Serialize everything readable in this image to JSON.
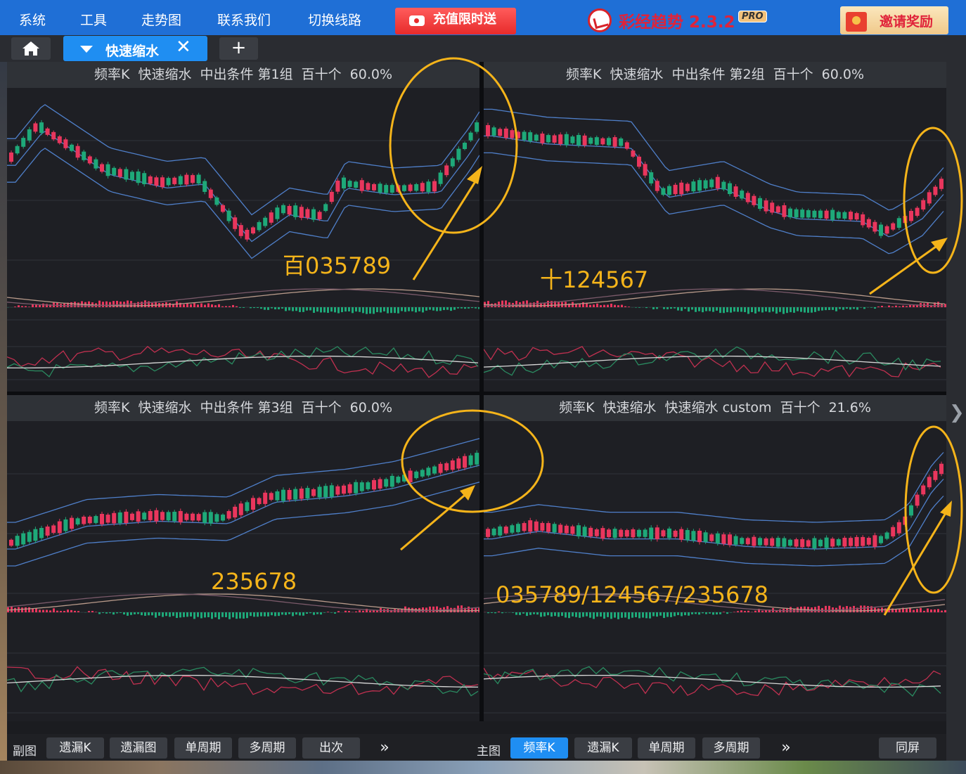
{
  "menu": {
    "items": [
      "系统",
      "工具",
      "走势图",
      "联系我们",
      "切换线路"
    ],
    "promo_label": "充值限时送",
    "app_title": "彩经趋势 2.3.2",
    "pro_badge": "PRO",
    "invite_label": "邀请奖励"
  },
  "tabs": {
    "active_label": "快速缩水",
    "close_glyph": "✕",
    "add_glyph": "+"
  },
  "panels": [
    {
      "title": [
        "频率K",
        "快速缩水",
        "中出条件 第1组",
        "百十个",
        "60.0%"
      ],
      "annotation": "百035789"
    },
    {
      "title": [
        "频率K",
        "快速缩水",
        "中出条件 第2组",
        "百十个",
        "60.0%"
      ],
      "annotation": "十124567"
    },
    {
      "title": [
        "频率K",
        "快速缩水",
        "中出条件 第3组",
        "百十个",
        "60.0%"
      ],
      "annotation": "235678"
    },
    {
      "title": [
        "频率K",
        "快速缩水",
        "快速缩水 custom",
        "百十个",
        "21.6%"
      ],
      "annotation": "035789/124567/235678"
    }
  ],
  "bottom": {
    "left_label": "副图",
    "left_buttons": [
      "遗漏K",
      "遗漏图",
      "单周期",
      "多周期",
      "出次"
    ],
    "right_label": "主图",
    "right_buttons": [
      "频率K",
      "遗漏K",
      "单周期",
      "多周期"
    ],
    "more_glyph": "»",
    "same_screen": "同屏",
    "selected": "频率K"
  },
  "colors": {
    "up": "#e9365d",
    "down": "#1ea979",
    "band": "#4f7fc9",
    "highlight": "#f5b41a",
    "brand_blue": "#1f6fd6"
  }
}
